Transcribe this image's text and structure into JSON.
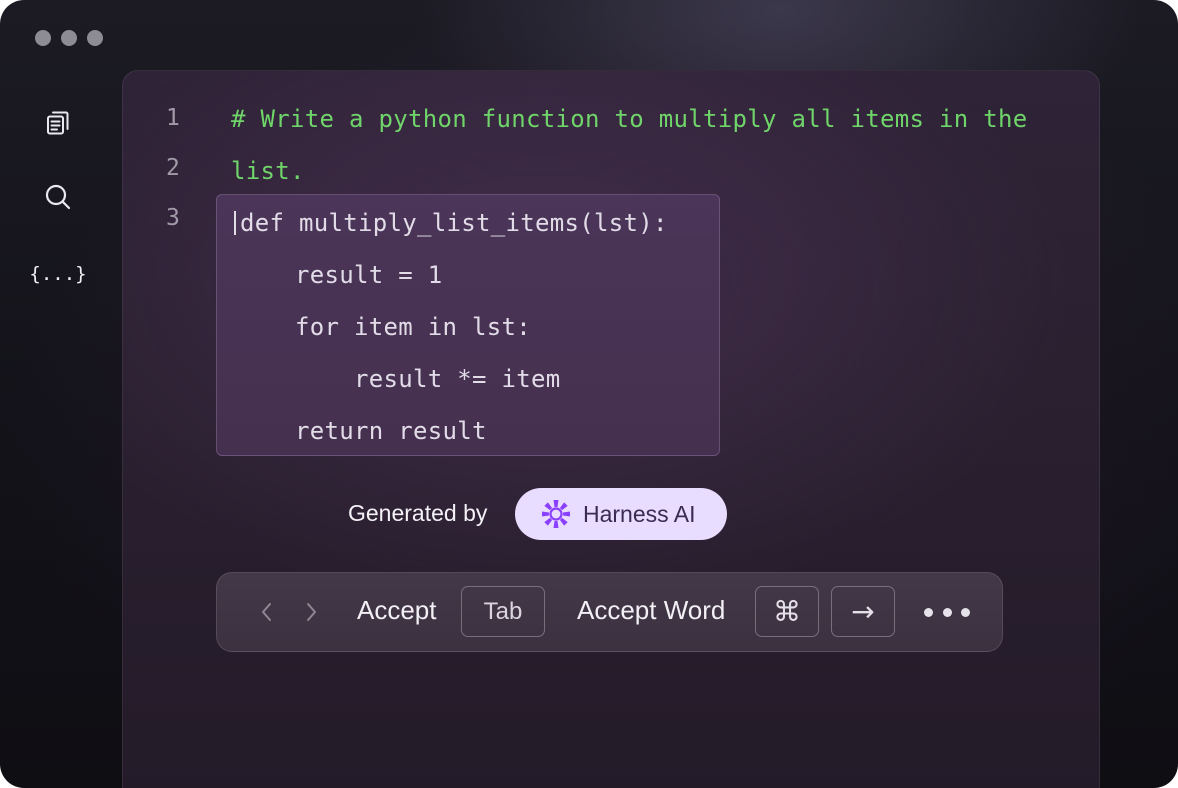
{
  "window": {
    "controls": [
      "close",
      "minimize",
      "maximize"
    ]
  },
  "sidebar": {
    "items": [
      {
        "icon": "copy-icon"
      },
      {
        "icon": "search-icon"
      },
      {
        "icon": "braces-icon",
        "label": "{...}"
      }
    ]
  },
  "editor": {
    "line_numbers": [
      "1",
      "2",
      "3"
    ],
    "comment_lines": [
      "# Write a python function to multiply all items in the",
      "list."
    ],
    "suggestion_lines": [
      "def multiply_list_items(lst):",
      "    result = 1",
      "    for item in lst:",
      "        result *= item",
      "    return result"
    ]
  },
  "attribution": {
    "prefix": "Generated by",
    "brand": "Harness AI",
    "brand_color": "#8a3ffc"
  },
  "toolbar": {
    "accept_label": "Accept",
    "accept_key": "Tab",
    "accept_word_label": "Accept Word",
    "accept_word_keys": [
      "⌘",
      "→"
    ]
  },
  "colors": {
    "comment": "#6fd46a",
    "code": "#e2dce8",
    "badge_bg": "#e8dcff"
  }
}
